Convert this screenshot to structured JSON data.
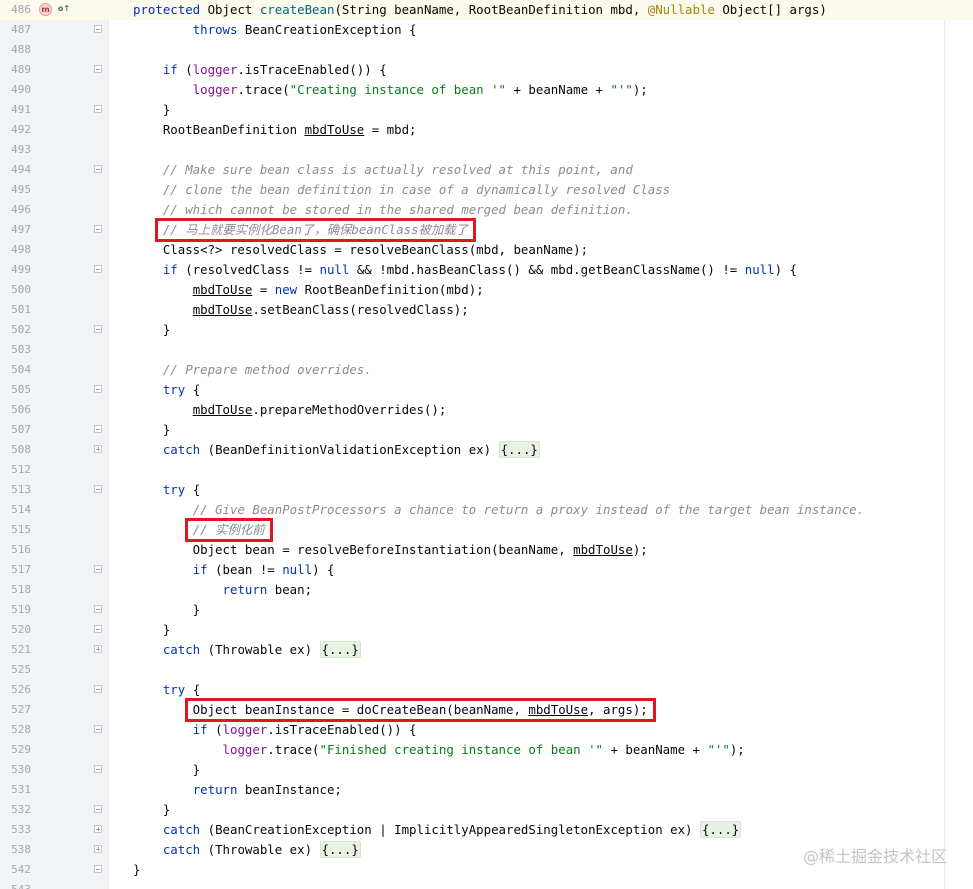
{
  "editor": {
    "lines": [
      {
        "n": "486",
        "fold": "none",
        "segs": [
          [
            "kw",
            "protected"
          ],
          [
            "t",
            " Object "
          ],
          [
            "fn",
            "createBean"
          ],
          [
            "t",
            "(String beanName, RootBeanDefinition mbd, "
          ],
          [
            "ann",
            "@Nullable"
          ],
          [
            "t",
            " Object[] args)"
          ]
        ]
      },
      {
        "n": "487",
        "fold": "open",
        "segs": [
          [
            "t",
            "        "
          ],
          [
            "kw",
            "throws"
          ],
          [
            "t",
            " BeanCreationException {"
          ]
        ]
      },
      {
        "n": "488",
        "fold": "none",
        "segs": []
      },
      {
        "n": "489",
        "fold": "open",
        "segs": [
          [
            "t",
            "    "
          ],
          [
            "kw",
            "if"
          ],
          [
            "t",
            " ("
          ],
          [
            "fld",
            "logger"
          ],
          [
            "t",
            ".isTraceEnabled()) {"
          ]
        ]
      },
      {
        "n": "490",
        "fold": "none",
        "segs": [
          [
            "t",
            "        "
          ],
          [
            "fld",
            "logger"
          ],
          [
            "t",
            ".trace("
          ],
          [
            "str",
            "\"Creating instance of bean '\""
          ],
          [
            "t",
            " + beanName + "
          ],
          [
            "str",
            "\"'\""
          ],
          [
            "t",
            ");"
          ]
        ]
      },
      {
        "n": "491",
        "fold": "open",
        "segs": [
          [
            "t",
            "    }"
          ]
        ]
      },
      {
        "n": "492",
        "fold": "none",
        "segs": [
          [
            "t",
            "    RootBeanDefinition "
          ],
          [
            "ul",
            "mbdToUse"
          ],
          [
            "t",
            " = mbd;"
          ]
        ]
      },
      {
        "n": "493",
        "fold": "none",
        "segs": []
      },
      {
        "n": "494",
        "fold": "open",
        "segs": [
          [
            "t",
            "    "
          ],
          [
            "cmt",
            "// Make sure bean class is actually resolved at this point, and"
          ]
        ]
      },
      {
        "n": "495",
        "fold": "none",
        "segs": [
          [
            "t",
            "    "
          ],
          [
            "cmt",
            "// clone the bean definition in case of a dynamically resolved Class"
          ]
        ]
      },
      {
        "n": "496",
        "fold": "none",
        "segs": [
          [
            "t",
            "    "
          ],
          [
            "cmt",
            "// which cannot be stored in the shared merged bean definition."
          ]
        ]
      },
      {
        "n": "497",
        "fold": "open",
        "segs": [
          [
            "t",
            "    "
          ],
          [
            "cmt",
            "// 马上就要实例化Bean了，确保beanClass被加载了"
          ]
        ]
      },
      {
        "n": "498",
        "fold": "none",
        "segs": [
          [
            "t",
            "    Class<?> resolvedClass = resolveBeanClass(mbd, beanName);"
          ]
        ]
      },
      {
        "n": "499",
        "fold": "open",
        "segs": [
          [
            "t",
            "    "
          ],
          [
            "kw",
            "if"
          ],
          [
            "t",
            " (resolvedClass != "
          ],
          [
            "kw",
            "null"
          ],
          [
            "t",
            " && !mbd.hasBeanClass() && mbd.getBeanClassName() != "
          ],
          [
            "kw",
            "null"
          ],
          [
            "t",
            ") {"
          ]
        ]
      },
      {
        "n": "500",
        "fold": "none",
        "segs": [
          [
            "t",
            "        "
          ],
          [
            "ul",
            "mbdToUse"
          ],
          [
            "t",
            " = "
          ],
          [
            "kw",
            "new"
          ],
          [
            "t",
            " RootBeanDefinition(mbd);"
          ]
        ]
      },
      {
        "n": "501",
        "fold": "none",
        "segs": [
          [
            "t",
            "        "
          ],
          [
            "ul",
            "mbdToUse"
          ],
          [
            "t",
            ".setBeanClass(resolvedClass);"
          ]
        ]
      },
      {
        "n": "502",
        "fold": "open",
        "segs": [
          [
            "t",
            "    }"
          ]
        ]
      },
      {
        "n": "503",
        "fold": "none",
        "segs": []
      },
      {
        "n": "504",
        "fold": "none",
        "segs": [
          [
            "t",
            "    "
          ],
          [
            "cmt",
            "// Prepare method overrides."
          ]
        ]
      },
      {
        "n": "505",
        "fold": "open",
        "segs": [
          [
            "t",
            "    "
          ],
          [
            "kw",
            "try"
          ],
          [
            "t",
            " {"
          ]
        ]
      },
      {
        "n": "506",
        "fold": "none",
        "segs": [
          [
            "t",
            "        "
          ],
          [
            "ul",
            "mbdToUse"
          ],
          [
            "t",
            ".prepareMethodOverrides();"
          ]
        ]
      },
      {
        "n": "507",
        "fold": "open",
        "segs": [
          [
            "t",
            "    }"
          ]
        ]
      },
      {
        "n": "508",
        "fold": "closed",
        "segs": [
          [
            "t",
            "    "
          ],
          [
            "kw",
            "catch"
          ],
          [
            "t",
            " (BeanDefinitionValidationException ex) "
          ],
          [
            "ph",
            "{...}"
          ]
        ]
      },
      {
        "n": "512",
        "fold": "none",
        "segs": []
      },
      {
        "n": "513",
        "fold": "open",
        "segs": [
          [
            "t",
            "    "
          ],
          [
            "kw",
            "try"
          ],
          [
            "t",
            " {"
          ]
        ]
      },
      {
        "n": "514",
        "fold": "none",
        "segs": [
          [
            "t",
            "        "
          ],
          [
            "cmt",
            "// Give BeanPostProcessors a chance to return a proxy instead of the target bean instance."
          ]
        ]
      },
      {
        "n": "515",
        "fold": "none",
        "segs": [
          [
            "t",
            "        "
          ],
          [
            "cmt",
            "// 实例化前"
          ]
        ]
      },
      {
        "n": "516",
        "fold": "none",
        "segs": [
          [
            "t",
            "        Object bean = resolveBeforeInstantiation(beanName, "
          ],
          [
            "ul",
            "mbdToUse"
          ],
          [
            "t",
            ");"
          ]
        ]
      },
      {
        "n": "517",
        "fold": "open",
        "segs": [
          [
            "t",
            "        "
          ],
          [
            "kw",
            "if"
          ],
          [
            "t",
            " (bean != "
          ],
          [
            "kw",
            "null"
          ],
          [
            "t",
            ") {"
          ]
        ]
      },
      {
        "n": "518",
        "fold": "none",
        "segs": [
          [
            "t",
            "            "
          ],
          [
            "kw",
            "return"
          ],
          [
            "t",
            " bean;"
          ]
        ]
      },
      {
        "n": "519",
        "fold": "open",
        "segs": [
          [
            "t",
            "        }"
          ]
        ]
      },
      {
        "n": "520",
        "fold": "open",
        "segs": [
          [
            "t",
            "    }"
          ]
        ]
      },
      {
        "n": "521",
        "fold": "closed",
        "segs": [
          [
            "t",
            "    "
          ],
          [
            "kw",
            "catch"
          ],
          [
            "t",
            " (Throwable ex) "
          ],
          [
            "ph",
            "{...}"
          ]
        ]
      },
      {
        "n": "525",
        "fold": "none",
        "segs": []
      },
      {
        "n": "526",
        "fold": "open",
        "segs": [
          [
            "t",
            "    "
          ],
          [
            "kw",
            "try"
          ],
          [
            "t",
            " {"
          ]
        ]
      },
      {
        "n": "527",
        "fold": "none",
        "segs": [
          [
            "t",
            "        Object beanInstance = doCreateBean(beanName, "
          ],
          [
            "ul",
            "mbdToUse"
          ],
          [
            "t",
            ", args);"
          ]
        ]
      },
      {
        "n": "528",
        "fold": "open",
        "segs": [
          [
            "t",
            "        "
          ],
          [
            "kw",
            "if"
          ],
          [
            "t",
            " ("
          ],
          [
            "fld",
            "logger"
          ],
          [
            "t",
            ".isTraceEnabled()) {"
          ]
        ]
      },
      {
        "n": "529",
        "fold": "none",
        "segs": [
          [
            "t",
            "            "
          ],
          [
            "fld",
            "logger"
          ],
          [
            "t",
            ".trace("
          ],
          [
            "str",
            "\"Finished creating instance of bean '\""
          ],
          [
            "t",
            " + beanName + "
          ],
          [
            "str",
            "\"'\""
          ],
          [
            "t",
            ");"
          ]
        ]
      },
      {
        "n": "530",
        "fold": "open",
        "segs": [
          [
            "t",
            "        }"
          ]
        ]
      },
      {
        "n": "531",
        "fold": "none",
        "segs": [
          [
            "t",
            "        "
          ],
          [
            "kw",
            "return"
          ],
          [
            "t",
            " beanInstance;"
          ]
        ]
      },
      {
        "n": "532",
        "fold": "open",
        "segs": [
          [
            "t",
            "    }"
          ]
        ]
      },
      {
        "n": "533",
        "fold": "closed",
        "segs": [
          [
            "t",
            "    "
          ],
          [
            "kw",
            "catch"
          ],
          [
            "t",
            " (BeanCreationException | ImplicitlyAppearedSingletonException ex) "
          ],
          [
            "ph",
            "{...}"
          ]
        ]
      },
      {
        "n": "538",
        "fold": "closed",
        "segs": [
          [
            "t",
            "    "
          ],
          [
            "kw",
            "catch"
          ],
          [
            "t",
            " (Throwable ex) "
          ],
          [
            "ph",
            "{...}"
          ]
        ]
      },
      {
        "n": "542",
        "fold": "open",
        "segs": [
          [
            "t",
            "}"
          ]
        ]
      },
      {
        "n": "543",
        "fold": "none",
        "segs": []
      }
    ]
  },
  "gutter_icons": {
    "override": "m",
    "implements": "o↑"
  },
  "highlight_lines": [
    "497",
    "515",
    "527"
  ],
  "watermark": "@稀土掘金技术社区",
  "colors": {
    "keyword": "#0033b3",
    "method": "#00627a",
    "string": "#067d17",
    "field": "#871094",
    "comment": "#8c8c8c",
    "annotation": "#9e880d",
    "highlight_box": "#e3161f"
  }
}
